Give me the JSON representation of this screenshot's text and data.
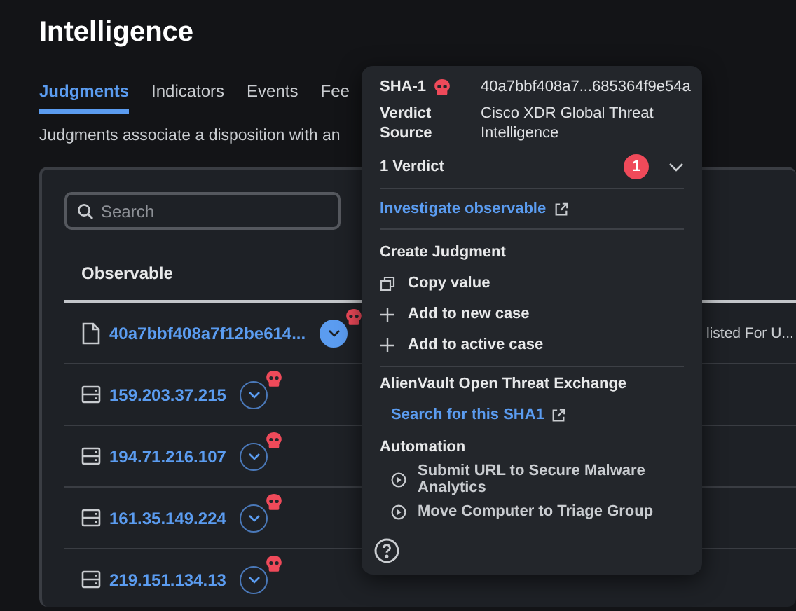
{
  "page": {
    "title": "Intelligence",
    "description": "Judgments associate a disposition with an"
  },
  "tabs": [
    {
      "label": "Judgments",
      "selected": true
    },
    {
      "label": "Indicators",
      "selected": false
    },
    {
      "label": "Events",
      "selected": false
    },
    {
      "label": "Fee",
      "selected": false
    }
  ],
  "search": {
    "placeholder": "Search"
  },
  "table": {
    "columns": [
      "Observable"
    ],
    "rows": [
      {
        "kind": "file",
        "value": "40a7bbf408a7f12be614...",
        "selected": true,
        "column_2": "listed For U..."
      },
      {
        "kind": "ip",
        "value": "159.203.37.215",
        "selected": false
      },
      {
        "kind": "ip",
        "value": "194.71.216.107",
        "selected": false
      },
      {
        "kind": "ip",
        "value": "161.35.149.224",
        "selected": false
      },
      {
        "kind": "ip",
        "value": "219.151.134.13",
        "selected": false
      }
    ]
  },
  "popover": {
    "hash_label": "SHA-1",
    "hash_value": "40a7bbf408a7...685364f9e54a",
    "source_label": "Verdict Source",
    "source_value": "Cisco XDR Global Threat Intelligence",
    "verdicts_label": "1 Verdict",
    "verdicts_count": "1",
    "investigate_link": "Investigate observable",
    "sections": [
      {
        "title": "Create Judgment",
        "items": [
          {
            "kind": "copy",
            "label": "Copy value"
          },
          {
            "kind": "add",
            "label": "Add to new case"
          },
          {
            "kind": "add",
            "label": "Add to active case"
          }
        ]
      },
      {
        "title": "AlienVault Open Threat Exchange",
        "items": [
          {
            "kind": "link",
            "label": "Search for this SHA1"
          }
        ]
      },
      {
        "title": "Automation",
        "items": [
          {
            "kind": "run",
            "label": "Submit URL to Secure Malware Analytics"
          },
          {
            "kind": "run",
            "label": "Move Computer to Triage Group"
          }
        ]
      }
    ]
  }
}
